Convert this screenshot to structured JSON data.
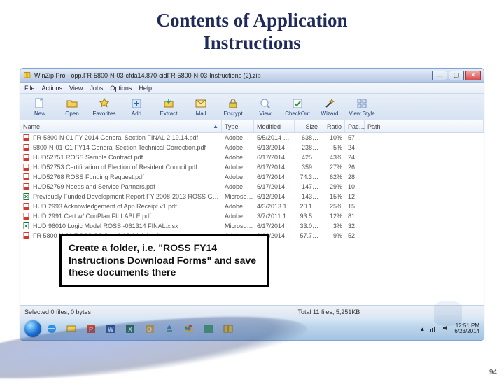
{
  "title_line1": "Contents of Application",
  "title_line2": "Instructions",
  "page_number": "94",
  "callout_text": "Create a folder, i.e. \"ROSS FY14 Instructions Download Forms\" and save these documents there",
  "window_title": "WinZip Pro - opp.FR-5800-N-03-cfda14.870-cidFR-5800-N-03-Instructions (2).zip",
  "menus": {
    "file": "File",
    "actions": "Actions",
    "view": "View",
    "jobs": "Jobs",
    "options": "Options",
    "help": "Help"
  },
  "toolbar": [
    {
      "k": "new",
      "label": "New"
    },
    {
      "k": "open",
      "label": "Open"
    },
    {
      "k": "favorites",
      "label": "Favorites"
    },
    {
      "k": "add",
      "label": "Add"
    },
    {
      "k": "extract",
      "label": "Extract"
    },
    {
      "k": "mail",
      "label": "Mail"
    },
    {
      "k": "encrypt",
      "label": "Encrypt"
    },
    {
      "k": "view",
      "label": "View"
    },
    {
      "k": "checkout",
      "label": "CheckOut"
    },
    {
      "k": "wizard",
      "label": "Wizard"
    },
    {
      "k": "viewstyle",
      "label": "View Style"
    }
  ],
  "columns": {
    "name": "Name",
    "type": "Type",
    "modified": "Modified",
    "size": "Size",
    "ratio": "Ratio",
    "packed": "Pac…",
    "path": "Path"
  },
  "files": [
    {
      "icon": "pdf",
      "name": "FR-5800-N-01 FY 2014 General Section FINAL 2.19.14.pdf",
      "type": "Adobe…",
      "modified": "5/5/2014 …",
      "size": "638…",
      "ratio": "10%",
      "packed": "57…"
    },
    {
      "icon": "pdf",
      "name": "5800-N-01-C1 FY14 General Section Technical Correction.pdf",
      "type": "Adobe…",
      "modified": "6/13/2014…",
      "size": "238…",
      "ratio": "5%",
      "packed": "24…"
    },
    {
      "icon": "pdf",
      "name": "HUD52751 ROSS Sample Contract.pdf",
      "type": "Adobe…",
      "modified": "6/17/2014…",
      "size": "425…",
      "ratio": "43%",
      "packed": "24…"
    },
    {
      "icon": "pdf",
      "name": "HUD52753 Certification of Election of Resident Council.pdf",
      "type": "Adobe…",
      "modified": "6/17/2014…",
      "size": "359…",
      "ratio": "27%",
      "packed": "26…"
    },
    {
      "icon": "pdf",
      "name": "HUD52768 ROSS Funding Request.pdf",
      "type": "Adobe…",
      "modified": "6/17/2014…",
      "size": "74.3…",
      "ratio": "62%",
      "packed": "28…"
    },
    {
      "icon": "pdf",
      "name": "HUD52769 Needs and Service Partners.pdf",
      "type": "Adobe…",
      "modified": "6/17/2014…",
      "size": "147…",
      "ratio": "29%",
      "packed": "10…"
    },
    {
      "icon": "xls",
      "name": "Previously Funded Development Report FY 2008-2013 ROSS Grantees FINAL.xlsx",
      "type": "Microso…",
      "modified": "6/12/2014…",
      "size": "143…",
      "ratio": "15%",
      "packed": "12…"
    },
    {
      "icon": "pdf",
      "name": "HUD 2993 Acknowledgement of App Receipt v1.pdf",
      "type": "Adobe…",
      "modified": "4/3/2013 1…",
      "size": "20.1…",
      "ratio": "25%",
      "packed": "15…"
    },
    {
      "icon": "pdf",
      "name": "HUD 2991 Cert w/ ConPlan FILLABLE.pdf",
      "type": "Adobe…",
      "modified": "3/7/2011 1…",
      "size": "93.5…",
      "ratio": "12%",
      "packed": "81…"
    },
    {
      "icon": "xls",
      "name": "HUD 96010 Logic Model ROSS -061314 FINAL.xlsx",
      "type": "Microso…",
      "modified": "6/17/2014…",
      "size": "33.0…",
      "ratio": "3%",
      "packed": "32…"
    },
    {
      "icon": "pdf",
      "name": "FR 5800 N-03 ROSS SC final 6.18.14 link.pdf",
      "type": "Adobe…",
      "modified": "6/18/2014…",
      "size": "57.7…",
      "ratio": "9%",
      "packed": "52…"
    }
  ],
  "statusbar": {
    "left": "Selected 0 files, 0 bytes",
    "mid": "Total 11 files, 5,251KB",
    "right": ""
  },
  "clock": {
    "time": "12:51 PM",
    "date": "6/23/2014"
  }
}
